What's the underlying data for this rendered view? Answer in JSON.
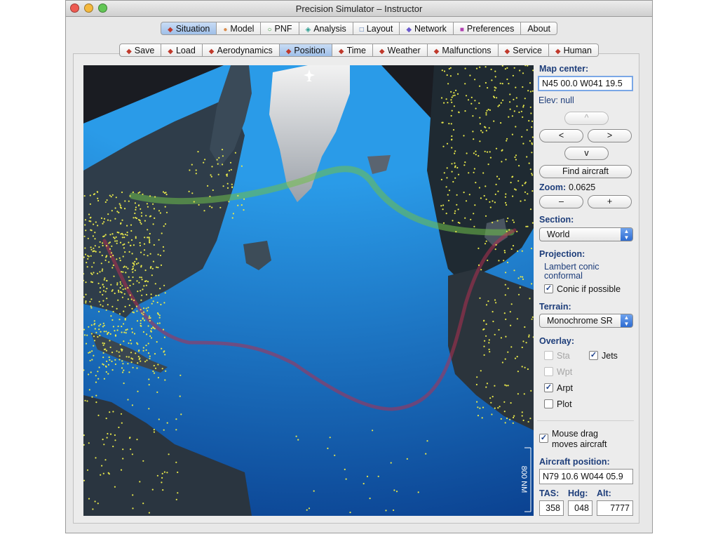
{
  "window": {
    "title": "Precision Simulator – Instructor",
    "colors": {
      "close": "#ee5b52",
      "minimize": "#f5b93e",
      "zoom": "#62c655"
    }
  },
  "main_tabs": [
    {
      "label": "Situation",
      "icon": "red-diamond-icon",
      "color": "#c0392b",
      "glyph": "◆",
      "selected": true
    },
    {
      "label": "Model",
      "icon": "orange-circle-icon",
      "color": "#d98b4b",
      "glyph": "●",
      "selected": false
    },
    {
      "label": "PNF",
      "icon": "green-circle-outline-icon",
      "color": "#3e9a3e",
      "glyph": "○",
      "selected": false
    },
    {
      "label": "Analysis",
      "icon": "teal-diamond-icon",
      "color": "#2a9d8f",
      "glyph": "◈",
      "selected": false
    },
    {
      "label": "Layout",
      "icon": "blue-square-outline-icon",
      "color": "#2d5fa8",
      "glyph": "□",
      "selected": false
    },
    {
      "label": "Network",
      "icon": "purple-diamond-icon",
      "color": "#6a5acd",
      "glyph": "◆",
      "selected": false
    },
    {
      "label": "Preferences",
      "icon": "magenta-square-icon",
      "color": "#b03fb0",
      "glyph": "■",
      "selected": false
    },
    {
      "label": "About",
      "icon": "",
      "color": "#000000",
      "glyph": "",
      "selected": false
    }
  ],
  "sub_tabs": [
    {
      "label": "Save",
      "selected": false
    },
    {
      "label": "Load",
      "selected": false
    },
    {
      "label": "Aerodynamics",
      "selected": false
    },
    {
      "label": "Position",
      "selected": true
    },
    {
      "label": "Time",
      "selected": false
    },
    {
      "label": "Weather",
      "selected": false
    },
    {
      "label": "Malfunctions",
      "selected": false
    },
    {
      "label": "Service",
      "selected": false
    },
    {
      "label": "Human",
      "selected": false
    }
  ],
  "sub_tab_icon": {
    "name": "red-diamond-icon",
    "glyph": "◆",
    "color": "#c0392b"
  },
  "map": {
    "scale_label": "800 NM",
    "colors": {
      "ocean_light": "#2a9be8",
      "ocean_dark": "#0a3f8e",
      "background": "#1a1c22",
      "airports": "#e8e84a",
      "jets_track": "#6fbf4a",
      "plot_track": "#b03050"
    }
  },
  "panel": {
    "map_center_label": "Map center:",
    "map_center_value": "N45 00.0 W041 19.5",
    "elev_text": "Elev: null",
    "nav_up": "^",
    "nav_left": "<",
    "nav_right": ">",
    "nav_down": "v",
    "find_aircraft": "Find aircraft",
    "zoom_label": "Zoom:",
    "zoom_value": "0.0625",
    "zoom_out": "–",
    "zoom_in": "+",
    "section_label": "Section:",
    "section_value": "World",
    "projection_label": "Projection:",
    "projection_line1": "Lambert conic",
    "projection_line2": "conformal",
    "conic_label": "Conic if possible",
    "terrain_label": "Terrain:",
    "terrain_value": "Monochrome SR",
    "overlay_label": "Overlay:",
    "overlay_sta": "Sta",
    "overlay_jets": "Jets",
    "overlay_wpt": "Wpt",
    "overlay_arpt": "Arpt",
    "overlay_plot": "Plot",
    "mouse_drag_line1": "Mouse drag",
    "mouse_drag_line2": "moves aircraft",
    "aircraft_position_label": "Aircraft position:",
    "aircraft_position_value": "N79 10.6 W044 05.9",
    "tas_label": "TAS:",
    "tas_value": "358",
    "hdg_label": "Hdg:",
    "hdg_value": "048",
    "alt_label": "Alt:",
    "alt_value": "7777"
  }
}
